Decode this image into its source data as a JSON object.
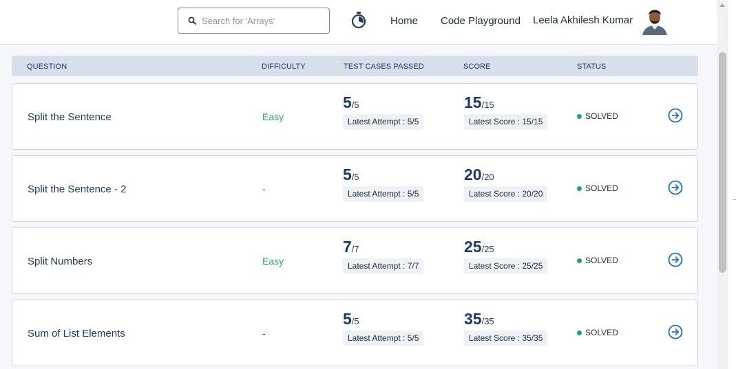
{
  "header": {
    "search_placeholder": "Search for 'Arrays'",
    "nav_home": "Home",
    "nav_code_playground": "Code Playground",
    "user_name": "Leela Akhilesh Kumar"
  },
  "table": {
    "columns": [
      "QUESTION",
      "DIFFICULTY",
      "TEST CASES PASSED",
      "SCORE",
      "STATUS"
    ],
    "rows": [
      {
        "question": "Split the Sentence",
        "difficulty": "Easy",
        "tests_passed": "5",
        "tests_total": "/5",
        "tests_fraction": 1.0,
        "latest_attempt": "Latest Attempt : 5/5",
        "score": "15",
        "score_total": "/15",
        "score_fraction": 1.0,
        "latest_score": "Latest Score : 15/15",
        "status": "SOLVED"
      },
      {
        "question": "Split the Sentence - 2",
        "difficulty": "-",
        "tests_passed": "5",
        "tests_total": "/5",
        "tests_fraction": 1.0,
        "latest_attempt": "Latest Attempt : 5/5",
        "score": "20",
        "score_total": "/20",
        "score_fraction": 1.0,
        "latest_score": "Latest Score : 20/20",
        "status": "SOLVED"
      },
      {
        "question": "Split Numbers",
        "difficulty": "Easy",
        "tests_passed": "7",
        "tests_total": "/7",
        "tests_fraction": 1.0,
        "latest_attempt": "Latest Attempt : 7/7",
        "score": "25",
        "score_total": "/25",
        "score_fraction": 1.0,
        "latest_score": "Latest Score : 25/25",
        "status": "SOLVED"
      },
      {
        "question": "Sum of List Elements",
        "difficulty": "-",
        "tests_passed": "5",
        "tests_total": "/5",
        "tests_fraction": 1.0,
        "latest_attempt": "Latest Attempt : 5/5",
        "score": "35",
        "score_total": "/35",
        "score_fraction": 1.0,
        "latest_score": "Latest Score : 35/35",
        "status": "SOLVED"
      }
    ]
  },
  "colors": {
    "accent": "#1c6fc2",
    "easy": "#1ea86a",
    "solved": "#1ea86a",
    "header_bg": "#d7deec"
  }
}
